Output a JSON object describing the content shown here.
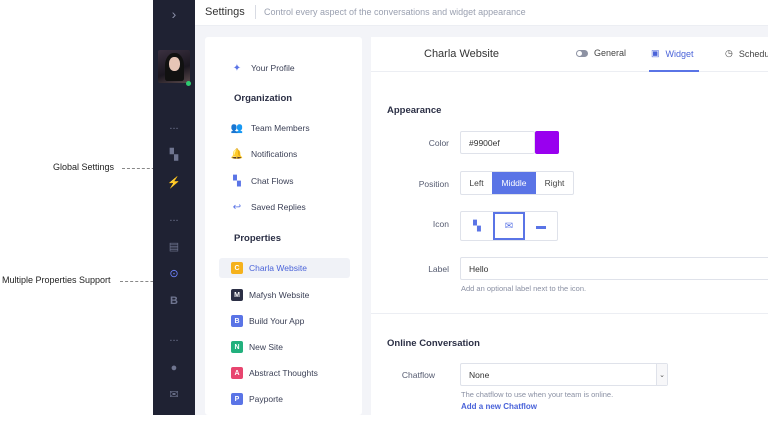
{
  "annotations": {
    "global_settings": "Global Settings",
    "multiple_properties": "Multiple Properties Support"
  },
  "header": {
    "title": "Settings",
    "subtitle": "Control every aspect of the conversations and widget appearance"
  },
  "rail": {
    "expand_icon": "chevron-right-icon",
    "ellipsis": "...",
    "status_color": "#2ecc71"
  },
  "panel": {
    "your_profile": "Your Profile",
    "organization_heading": "Organization",
    "org_items": [
      "Team Members",
      "Notifications",
      "Chat Flows",
      "Saved Replies"
    ],
    "properties_heading": "Properties",
    "properties": [
      {
        "letter": "C",
        "name": "Charla Website",
        "color": "#f5b21c",
        "selected": true
      },
      {
        "letter": "M",
        "name": "Mafysh Website",
        "color": "#2b2f45",
        "selected": false
      },
      {
        "letter": "B",
        "name": "Build Your App",
        "color": "#5a74e6",
        "selected": false
      },
      {
        "letter": "N",
        "name": "New Site",
        "color": "#22b07d",
        "selected": false
      },
      {
        "letter": "A",
        "name": "Abstract Thoughts",
        "color": "#e8456f",
        "selected": false
      },
      {
        "letter": "P",
        "name": "Payporte",
        "color": "#5a74e6",
        "selected": false
      }
    ]
  },
  "main": {
    "site_name": "Charla Website",
    "tabs": [
      "General",
      "Widget",
      "Schedule"
    ],
    "active_tab": "Widget",
    "appearance_heading": "Appearance",
    "color_label": "Color",
    "color_value": "#9900ef",
    "position_label": "Position",
    "position_options": [
      "Left",
      "Middle",
      "Right"
    ],
    "position_selected": "Middle",
    "icon_label": "Icon",
    "label_label": "Label",
    "label_value": "Hello",
    "label_hint": "Add an optional label next to the icon.",
    "online_heading": "Online Conversation",
    "chatflow_label": "Chatflow",
    "chatflow_value": "None",
    "chatflow_hint": "The chatflow to use when your team is online.",
    "chatflow_link": "Add a new Chatflow"
  },
  "colors": {
    "accent": "#5a74e6",
    "sidebar": "#1f2233",
    "swatch": "#9900ef"
  }
}
